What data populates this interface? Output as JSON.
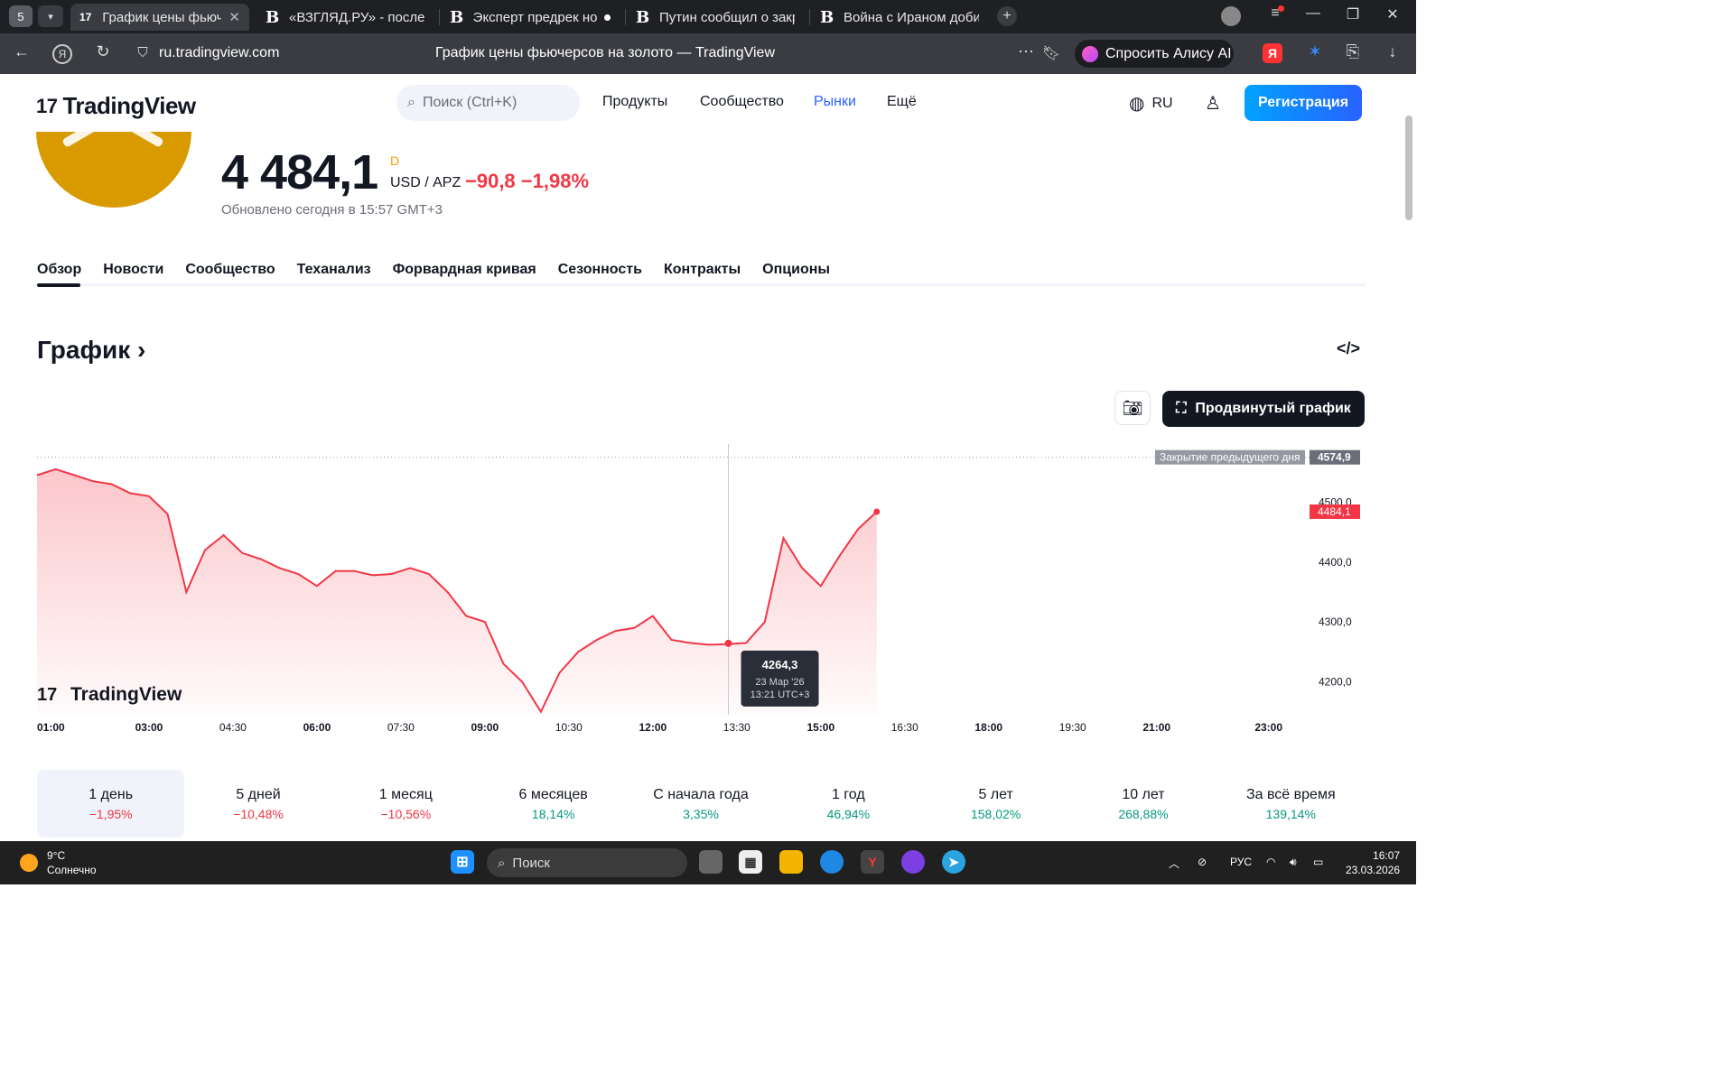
{
  "browser": {
    "tab_count": "5",
    "tabs": [
      {
        "title": "График цены фьючерсов на",
        "favicon": "tradingview",
        "active": true
      },
      {
        "title": "«ВЗГЛЯД.РУ» - последние",
        "favicon": "В",
        "active": false
      },
      {
        "title": "Эксперт предрек новые",
        "favicon": "В",
        "active": false
      },
      {
        "title": "Путин сообщил о закреп",
        "favicon": "В",
        "active": false
      },
      {
        "title": "Война с Ираном добивает",
        "favicon": "В",
        "active": false
      }
    ],
    "url": "ru.tradingview.com",
    "page_title": "График цены фьючерсов на золото — TradingView",
    "alice_label": "Спросить Алису AI"
  },
  "site": {
    "brand": "TradingView",
    "search_placeholder": "Поиск (Ctrl+K)",
    "nav": [
      "Продукты",
      "Сообщество",
      "Рынки",
      "Ещё"
    ],
    "active_nav": "Рынки",
    "lang": "RU",
    "signup": "Регистрация"
  },
  "quote": {
    "price": "4 484,1",
    "period_badge": "D",
    "currency": "USD / АРZ",
    "change": "−90,8",
    "change_pct": "−1,98%",
    "updated": "Обновлено сегодня в 15:57 GMT+3"
  },
  "subtabs": [
    "Обзор",
    "Новости",
    "Сообщество",
    "Теханализ",
    "Форвардная кривая",
    "Сезонность",
    "Контракты",
    "Опционы"
  ],
  "chart_section": {
    "title": "График",
    "advanced_button": "Продвинутый график",
    "watermark": "TradingView"
  },
  "chart_data": {
    "type": "area",
    "x_ticks": [
      "01:00",
      "03:00",
      "04:30",
      "06:00",
      "07:30",
      "09:00",
      "10:30",
      "12:00",
      "13:30",
      "15:00",
      "16:30",
      "18:00",
      "19:30",
      "21:00",
      "23:00"
    ],
    "y_ticks": [
      "4500,0",
      "4400,0",
      "4300,0",
      "4200,0"
    ],
    "ylim": [
      4145,
      4585
    ],
    "prev_close_label": "Закрытие предыдущего дня",
    "prev_close": 4574.9,
    "prev_close_text": "4574,9",
    "last_price": 4484.1,
    "last_price_text": "4484,1",
    "series": [
      {
        "x": [
          "01:00",
          "01:20",
          "01:40",
          "02:00",
          "02:20",
          "02:40",
          "03:00",
          "03:20",
          "03:40",
          "04:00",
          "04:20",
          "04:40",
          "05:00",
          "05:20",
          "05:40",
          "06:00",
          "06:20",
          "06:40",
          "07:00",
          "07:20",
          "07:40",
          "08:00",
          "08:20",
          "08:40",
          "09:00",
          "09:20",
          "09:40",
          "10:00",
          "10:20",
          "10:40",
          "11:00",
          "11:20",
          "11:40",
          "12:00",
          "12:20",
          "12:40",
          "13:00",
          "13:20",
          "13:40",
          "14:00",
          "14:20",
          "14:40",
          "15:00",
          "15:20",
          "15:40",
          "16:00"
        ],
        "y": [
          4545,
          4555,
          4545,
          4535,
          4530,
          4515,
          4510,
          4480,
          4350,
          4420,
          4445,
          4415,
          4405,
          4390,
          4380,
          4360,
          4385,
          4385,
          4378,
          4380,
          4390,
          4380,
          4350,
          4310,
          4300,
          4230,
          4200,
          4150,
          4215,
          4250,
          4270,
          4285,
          4290,
          4310,
          4270,
          4265,
          4262,
          4263,
          4265,
          4300,
          4440,
          4390,
          4360,
          4410,
          4455,
          4484
        ]
      }
    ],
    "tooltip": {
      "value": "4264,3",
      "date": "23 Мар '26",
      "time": "13:21 UTC+3",
      "x": "13:21",
      "y": 4264.3
    }
  },
  "performance": [
    {
      "label": "1 день",
      "value": "−1,95%",
      "sign": "neg",
      "selected": true
    },
    {
      "label": "5 дней",
      "value": "−10,48%",
      "sign": "neg"
    },
    {
      "label": "1 месяц",
      "value": "−10,56%",
      "sign": "neg"
    },
    {
      "label": "6 месяцев",
      "value": "18,14%",
      "sign": "pos"
    },
    {
      "label": "С начала года",
      "value": "3,35%",
      "sign": "pos"
    },
    {
      "label": "1 год",
      "value": "46,94%",
      "sign": "pos"
    },
    {
      "label": "5 лет",
      "value": "158,02%",
      "sign": "pos"
    },
    {
      "label": "10 лет",
      "value": "268,88%",
      "sign": "pos"
    },
    {
      "label": "За всё время",
      "value": "139,14%",
      "sign": "pos"
    }
  ],
  "taskbar": {
    "weather_temp": "9°C",
    "weather_desc": "Солнечно",
    "search": "Поиск",
    "lang": "РУС",
    "time": "16:07",
    "date": "23.03.2026"
  },
  "colors": {
    "accent": "#2962ff",
    "down": "#f23645",
    "up": "#089981",
    "gold": "#d99a00"
  }
}
